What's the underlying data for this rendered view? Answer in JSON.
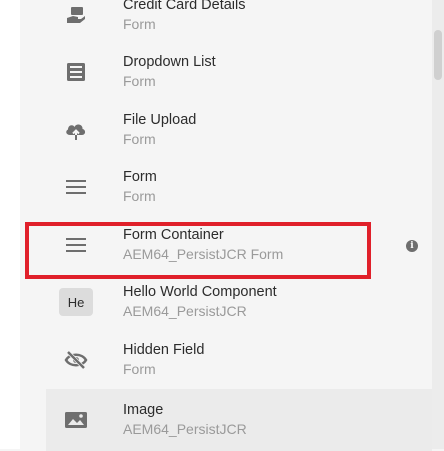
{
  "components": [
    {
      "title": "Credit Card Details",
      "group": "Form",
      "icon": "credit-card-hand-icon"
    },
    {
      "title": "Dropdown List",
      "group": "Form",
      "icon": "dropdown-list-icon"
    },
    {
      "title": "File Upload",
      "group": "Form",
      "icon": "cloud-upload-icon"
    },
    {
      "title": "Form",
      "group": "Form",
      "icon": "form-lines-icon"
    },
    {
      "title": "Form Container",
      "group": "AEM64_PersistJCR Form",
      "icon": "form-lines-icon"
    },
    {
      "title": "Hello World Component",
      "group": "AEM64_PersistJCR",
      "icon": "text-badge",
      "badge": "He"
    },
    {
      "title": "Hidden Field",
      "group": "Form",
      "icon": "eye-slash-icon"
    },
    {
      "title": "Image",
      "group": "AEM64_PersistJCR",
      "icon": "image-icon"
    }
  ],
  "info_label": "i",
  "colors": {
    "highlight": "#e0202a",
    "icon": "#6e6e6e",
    "title": "#2c2c2c",
    "subtitle": "#9a9a9a"
  }
}
